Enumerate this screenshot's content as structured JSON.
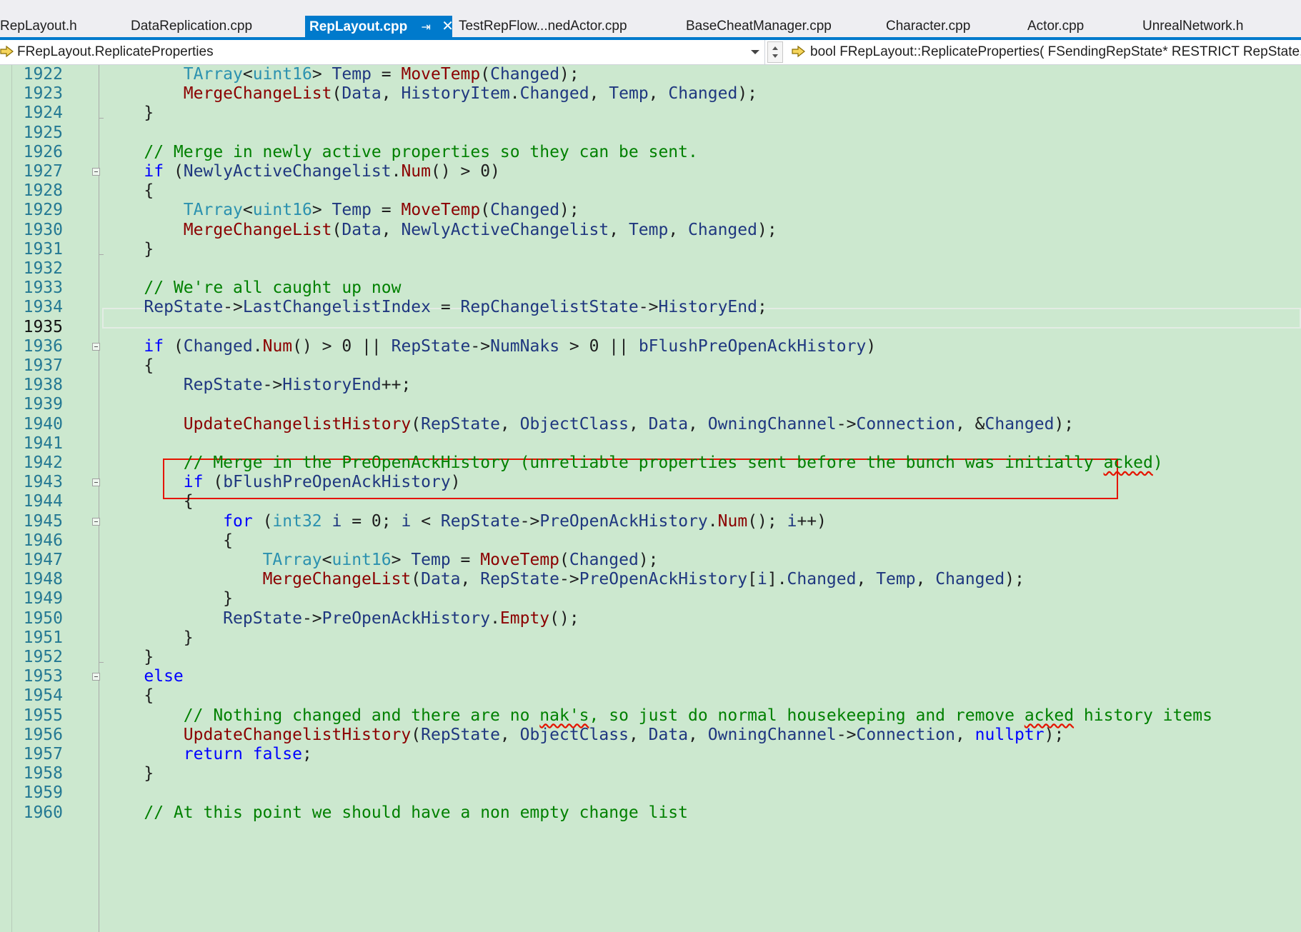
{
  "tabs": [
    {
      "label": "RepLayout.h",
      "active": false
    },
    {
      "label": "DataReplication.cpp",
      "active": false
    },
    {
      "label": "RepLayout.cpp",
      "active": true
    },
    {
      "label": "TestRepFlow...nedActor.cpp",
      "active": false
    },
    {
      "label": "BaseCheatManager.cpp",
      "active": false
    },
    {
      "label": "Character.cpp",
      "active": false
    },
    {
      "label": "Actor.cpp",
      "active": false
    },
    {
      "label": "UnrealNetwork.h",
      "active": false
    }
  ],
  "tab_icons": {
    "pin": "pin-icon",
    "close": "close-icon"
  },
  "nav": {
    "scope": "FRepLayout.ReplicateProperties",
    "member": "bool FRepLayout::ReplicateProperties( FSendingRepState* RESTRICT RepState, F"
  },
  "editor": {
    "current_line": 1935,
    "highlight_box_line": 1940,
    "colors": {
      "background": "#cce8cf",
      "keyword": "#0000ff",
      "comment": "#008000",
      "function": "#8b0000",
      "type": "#2b91af",
      "variable": "#1f377f",
      "highlight_box": "#e51400",
      "tab_active": "#007acc"
    },
    "lines": [
      {
        "n": "1922",
        "code": "        TArray<uint16> Temp = MoveTemp(Changed);"
      },
      {
        "n": "1923",
        "code": "        MergeChangeList(Data, HistoryItem.Changed, Temp, Changed);"
      },
      {
        "n": "1924",
        "code": "    }"
      },
      {
        "n": "1925",
        "code": ""
      },
      {
        "n": "1926",
        "code": "    // Merge in newly active properties so they can be sent."
      },
      {
        "n": "1927",
        "code": "    if (NewlyActiveChangelist.Num() > 0)"
      },
      {
        "n": "1928",
        "code": "    {"
      },
      {
        "n": "1929",
        "code": "        TArray<uint16> Temp = MoveTemp(Changed);"
      },
      {
        "n": "1930",
        "code": "        MergeChangeList(Data, NewlyActiveChangelist, Temp, Changed);"
      },
      {
        "n": "1931",
        "code": "    }"
      },
      {
        "n": "1932",
        "code": ""
      },
      {
        "n": "1933",
        "code": "    // We're all caught up now"
      },
      {
        "n": "1934",
        "code": "    RepState->LastChangelistIndex = RepChangelistState->HistoryEnd;"
      },
      {
        "n": "1935",
        "code": ""
      },
      {
        "n": "1936",
        "code": "    if (Changed.Num() > 0 || RepState->NumNaks > 0 || bFlushPreOpenAckHistory)"
      },
      {
        "n": "1937",
        "code": "    {"
      },
      {
        "n": "1938",
        "code": "        RepState->HistoryEnd++;"
      },
      {
        "n": "1939",
        "code": ""
      },
      {
        "n": "1940",
        "code": "        UpdateChangelistHistory(RepState, ObjectClass, Data, OwningChannel->Connection, &Changed);"
      },
      {
        "n": "1941",
        "code": ""
      },
      {
        "n": "1942",
        "code": "        // Merge in the PreOpenAckHistory (unreliable properties sent before the bunch was initially acked)"
      },
      {
        "n": "1943",
        "code": "        if (bFlushPreOpenAckHistory)"
      },
      {
        "n": "1944",
        "code": "        {"
      },
      {
        "n": "1945",
        "code": "            for (int32 i = 0; i < RepState->PreOpenAckHistory.Num(); i++)"
      },
      {
        "n": "1946",
        "code": "            {"
      },
      {
        "n": "1947",
        "code": "                TArray<uint16> Temp = MoveTemp(Changed);"
      },
      {
        "n": "1948",
        "code": "                MergeChangeList(Data, RepState->PreOpenAckHistory[i].Changed, Temp, Changed);"
      },
      {
        "n": "1949",
        "code": "            }"
      },
      {
        "n": "1950",
        "code": "            RepState->PreOpenAckHistory.Empty();"
      },
      {
        "n": "1951",
        "code": "        }"
      },
      {
        "n": "1952",
        "code": "    }"
      },
      {
        "n": "1953",
        "code": "    else"
      },
      {
        "n": "1954",
        "code": "    {"
      },
      {
        "n": "1955",
        "code": "        // Nothing changed and there are no nak's, so just do normal housekeeping and remove acked history items"
      },
      {
        "n": "1956",
        "code": "        UpdateChangelistHistory(RepState, ObjectClass, Data, OwningChannel->Connection, nullptr);"
      },
      {
        "n": "1957",
        "code": "        return false;"
      },
      {
        "n": "1958",
        "code": "    }"
      },
      {
        "n": "1959",
        "code": ""
      },
      {
        "n": "1960",
        "code": "    // At this point we should have a non empty change list"
      }
    ]
  }
}
